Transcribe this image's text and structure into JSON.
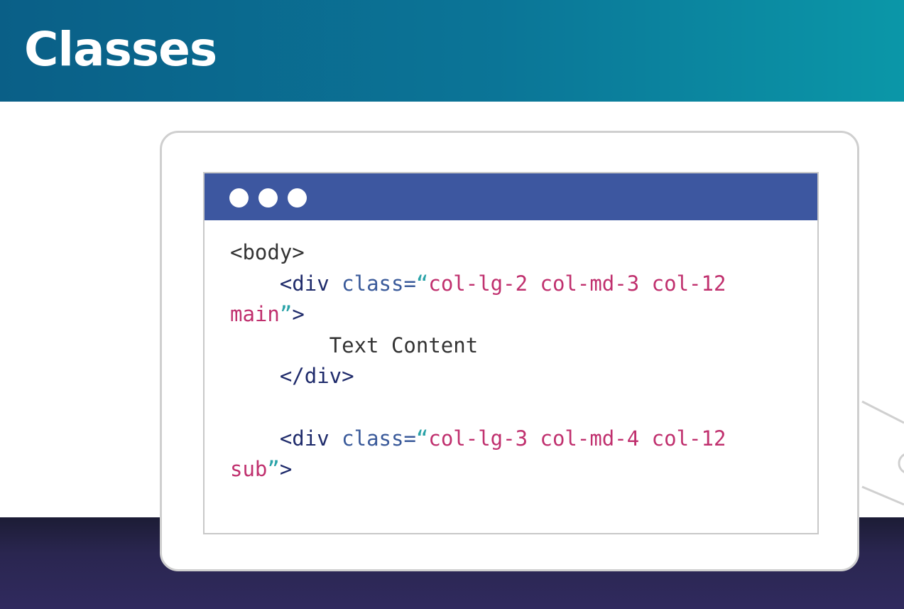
{
  "slide": {
    "title": "Classes"
  },
  "code": {
    "lines": [
      [
        {
          "t": "<body>",
          "c": "plain"
        }
      ],
      [
        {
          "t": "    ",
          "c": "plain"
        },
        {
          "t": "<div",
          "c": "tag"
        },
        {
          "t": " class=",
          "c": "attr"
        },
        {
          "t": "“",
          "c": "q"
        },
        {
          "t": "col-lg-2 col-md-3 col-12",
          "c": "val"
        }
      ],
      [
        {
          "t": "main",
          "c": "val"
        },
        {
          "t": "”",
          "c": "q"
        },
        {
          "t": ">",
          "c": "tag"
        }
      ],
      [
        {
          "t": "        Text Content",
          "c": "plain"
        }
      ],
      [
        {
          "t": "    ",
          "c": "plain"
        },
        {
          "t": "</div>",
          "c": "tag"
        }
      ],
      [
        {
          "t": "",
          "c": "plain"
        }
      ],
      [
        {
          "t": "    ",
          "c": "plain"
        },
        {
          "t": "<div",
          "c": "tag"
        },
        {
          "t": " class=",
          "c": "attr"
        },
        {
          "t": "“",
          "c": "q"
        },
        {
          "t": "col-lg-3 col-md-4 col-12",
          "c": "val"
        }
      ],
      [
        {
          "t": "sub",
          "c": "val"
        },
        {
          "t": "”",
          "c": "q"
        },
        {
          "t": ">",
          "c": "tag"
        }
      ]
    ]
  },
  "colors": {
    "header_start": "#0a5f87",
    "header_end": "#0b97a8",
    "window_bar": "#3d57a0",
    "tag": "#1f2b6b",
    "attr": "#3a5a9a",
    "quote": "#2aa3a8",
    "value": "#c0306e",
    "text": "#333333"
  }
}
